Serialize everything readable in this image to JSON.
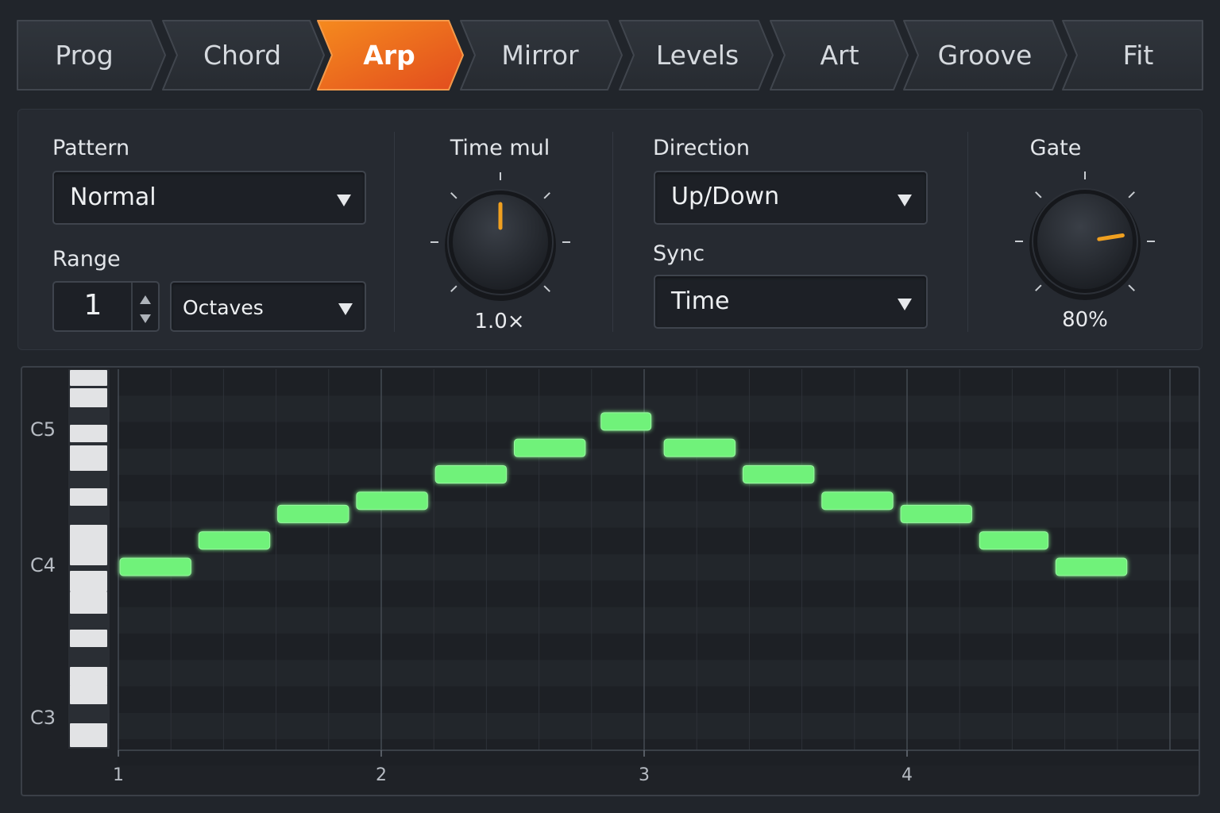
{
  "tabs": [
    {
      "label": "Prog",
      "active": false
    },
    {
      "label": "Chord",
      "active": false
    },
    {
      "label": "Arp",
      "active": true
    },
    {
      "label": "Mirror",
      "active": false
    },
    {
      "label": "Levels",
      "active": false
    },
    {
      "label": "Art",
      "active": false
    },
    {
      "label": "Groove",
      "active": false
    },
    {
      "label": "Fit",
      "active": false
    }
  ],
  "colors": {
    "accent": "#f07a1a",
    "accent_dark": "#e4541f",
    "note": "#6ff27a",
    "knob_indicator": "#f0a020"
  },
  "pattern": {
    "label": "Pattern",
    "value": "Normal"
  },
  "range": {
    "label": "Range",
    "value": "1",
    "unit": "Octaves"
  },
  "time_mul": {
    "label": "Time mul",
    "value": "1.0×",
    "level": 0.5
  },
  "direction": {
    "label": "Direction",
    "value": "Up/Down"
  },
  "sync": {
    "label": "Sync",
    "value": "Time"
  },
  "gate": {
    "label": "Gate",
    "value": "80%",
    "level": 0.8
  },
  "piano_roll": {
    "key_labels": [
      "C5",
      "C4",
      "C3"
    ],
    "bar_labels": [
      "1",
      "2",
      "3",
      "4"
    ],
    "notes": [
      {
        "start": 1.0,
        "length": 0.27,
        "pitch": "C4"
      },
      {
        "start": 1.3,
        "length": 0.27,
        "pitch": "D4"
      },
      {
        "start": 1.6,
        "length": 0.27,
        "pitch": "E4"
      },
      {
        "start": 1.9,
        "length": 0.27,
        "pitch": "F4"
      },
      {
        "start": 2.2,
        "length": 0.27,
        "pitch": "G4"
      },
      {
        "start": 2.5,
        "length": 0.27,
        "pitch": "A4"
      },
      {
        "start": 2.83,
        "length": 0.19,
        "pitch": "B4"
      },
      {
        "start": 3.07,
        "length": 0.27,
        "pitch": "A4"
      },
      {
        "start": 3.37,
        "length": 0.27,
        "pitch": "G4"
      },
      {
        "start": 3.67,
        "length": 0.27,
        "pitch": "F4"
      },
      {
        "start": 3.97,
        "length": 0.27,
        "pitch": "E4"
      },
      {
        "start": 4.27,
        "length": 0.26,
        "pitch": "D4"
      },
      {
        "start": 4.56,
        "length": 0.27,
        "pitch": "C4"
      }
    ]
  }
}
